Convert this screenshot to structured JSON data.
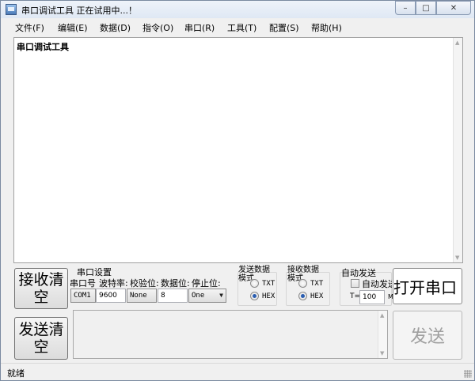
{
  "window": {
    "title": "串口调试工具   正在试用中...！"
  },
  "window_buttons": {
    "minimize": "–",
    "maximize": "□",
    "close": "✕"
  },
  "menu": [
    {
      "label": "文件(F)"
    },
    {
      "label": "编辑(E)"
    },
    {
      "label": "数据(D)"
    },
    {
      "label": "指令(O)"
    },
    {
      "label": "串口(R)"
    },
    {
      "label": "工具(T)"
    },
    {
      "label": "配置(S)"
    },
    {
      "label": "帮助(H)"
    }
  ],
  "receive": {
    "text": "串口调试工具"
  },
  "buttons": {
    "clear_receive": "接收清空",
    "clear_send": "发送清空",
    "open_port": "打开串口",
    "send": "发送"
  },
  "port_settings": {
    "title": "串口设置",
    "port_label": "串口号:",
    "port_value": "COM1",
    "baud_label": "波特率:",
    "baud_value": "9600",
    "parity_label": "校验位:",
    "parity_value": "None",
    "databits_label": "数据位:",
    "databits_value": "8",
    "stopbits_label": "停止位:",
    "stopbits_value": "One"
  },
  "send_mode": {
    "title": "发送数据模式",
    "txt": "TXT",
    "hex": "HEX",
    "selected": "HEX"
  },
  "recv_mode": {
    "title": "接收数据模式",
    "txt": "TXT",
    "hex": "HEX",
    "selected": "HEX"
  },
  "auto_send": {
    "title": "自动发送",
    "checkbox_label": "自动发送",
    "checked": false,
    "interval_label": "T=",
    "interval_value": "100",
    "unit": "M"
  },
  "status": {
    "text": "就绪"
  }
}
